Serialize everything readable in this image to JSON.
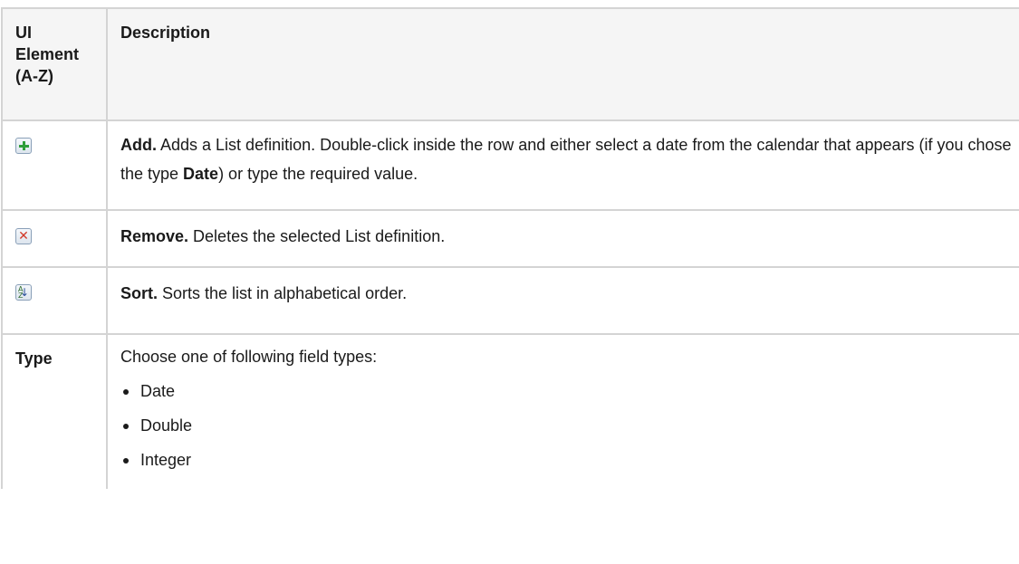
{
  "header": {
    "col1": "UI Element (A-Z)",
    "col1_lines": [
      "UI",
      "Element",
      "(A-Z)"
    ],
    "col2": "Description"
  },
  "rows": {
    "add": {
      "icon": "add-icon",
      "term": "Add.",
      "text1": " Adds a List definition. Double-click inside the row and either select a date from the calendar that appears (if you chose the type ",
      "bold_word": "Date",
      "text2": ") or type the required value."
    },
    "remove": {
      "icon": "remove-icon",
      "term": "Remove.",
      "text": " Deletes the selected List definition."
    },
    "sort": {
      "icon": "sort-icon",
      "term": "Sort.",
      "text": " Sorts the list in alphabetical order."
    },
    "type": {
      "label": "Type",
      "intro": "Choose one of following field types:",
      "options": [
        "Date",
        "Double",
        "Integer"
      ]
    }
  },
  "colors": {
    "border": "#d4d4d4",
    "header_bg": "#f5f5f5",
    "add_green": "#2e9e3a",
    "remove_red": "#d23a2a"
  }
}
